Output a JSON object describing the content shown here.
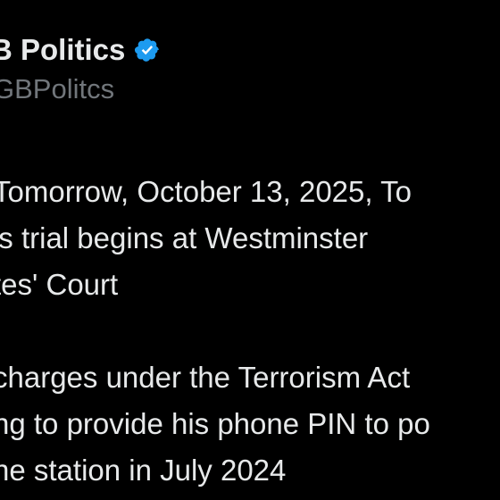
{
  "author": {
    "display_name": "B Politics",
    "handle": "GBPolitcs",
    "verified_icon": "verified-badge-icon",
    "verified_color": "#1d9bf0"
  },
  "tweet": {
    "paragraph_1": [
      "Tomorrow, October 13, 2025, To",
      "'s trial begins at Westminster",
      "tes' Court"
    ],
    "paragraph_2": [
      "charges under the Terrorism Act",
      "ng to provide his phone PIN to po",
      "ne station in July 2024"
    ]
  },
  "colors": {
    "background": "#000000",
    "text_primary": "#e7e9ea",
    "text_secondary": "#71767b"
  }
}
